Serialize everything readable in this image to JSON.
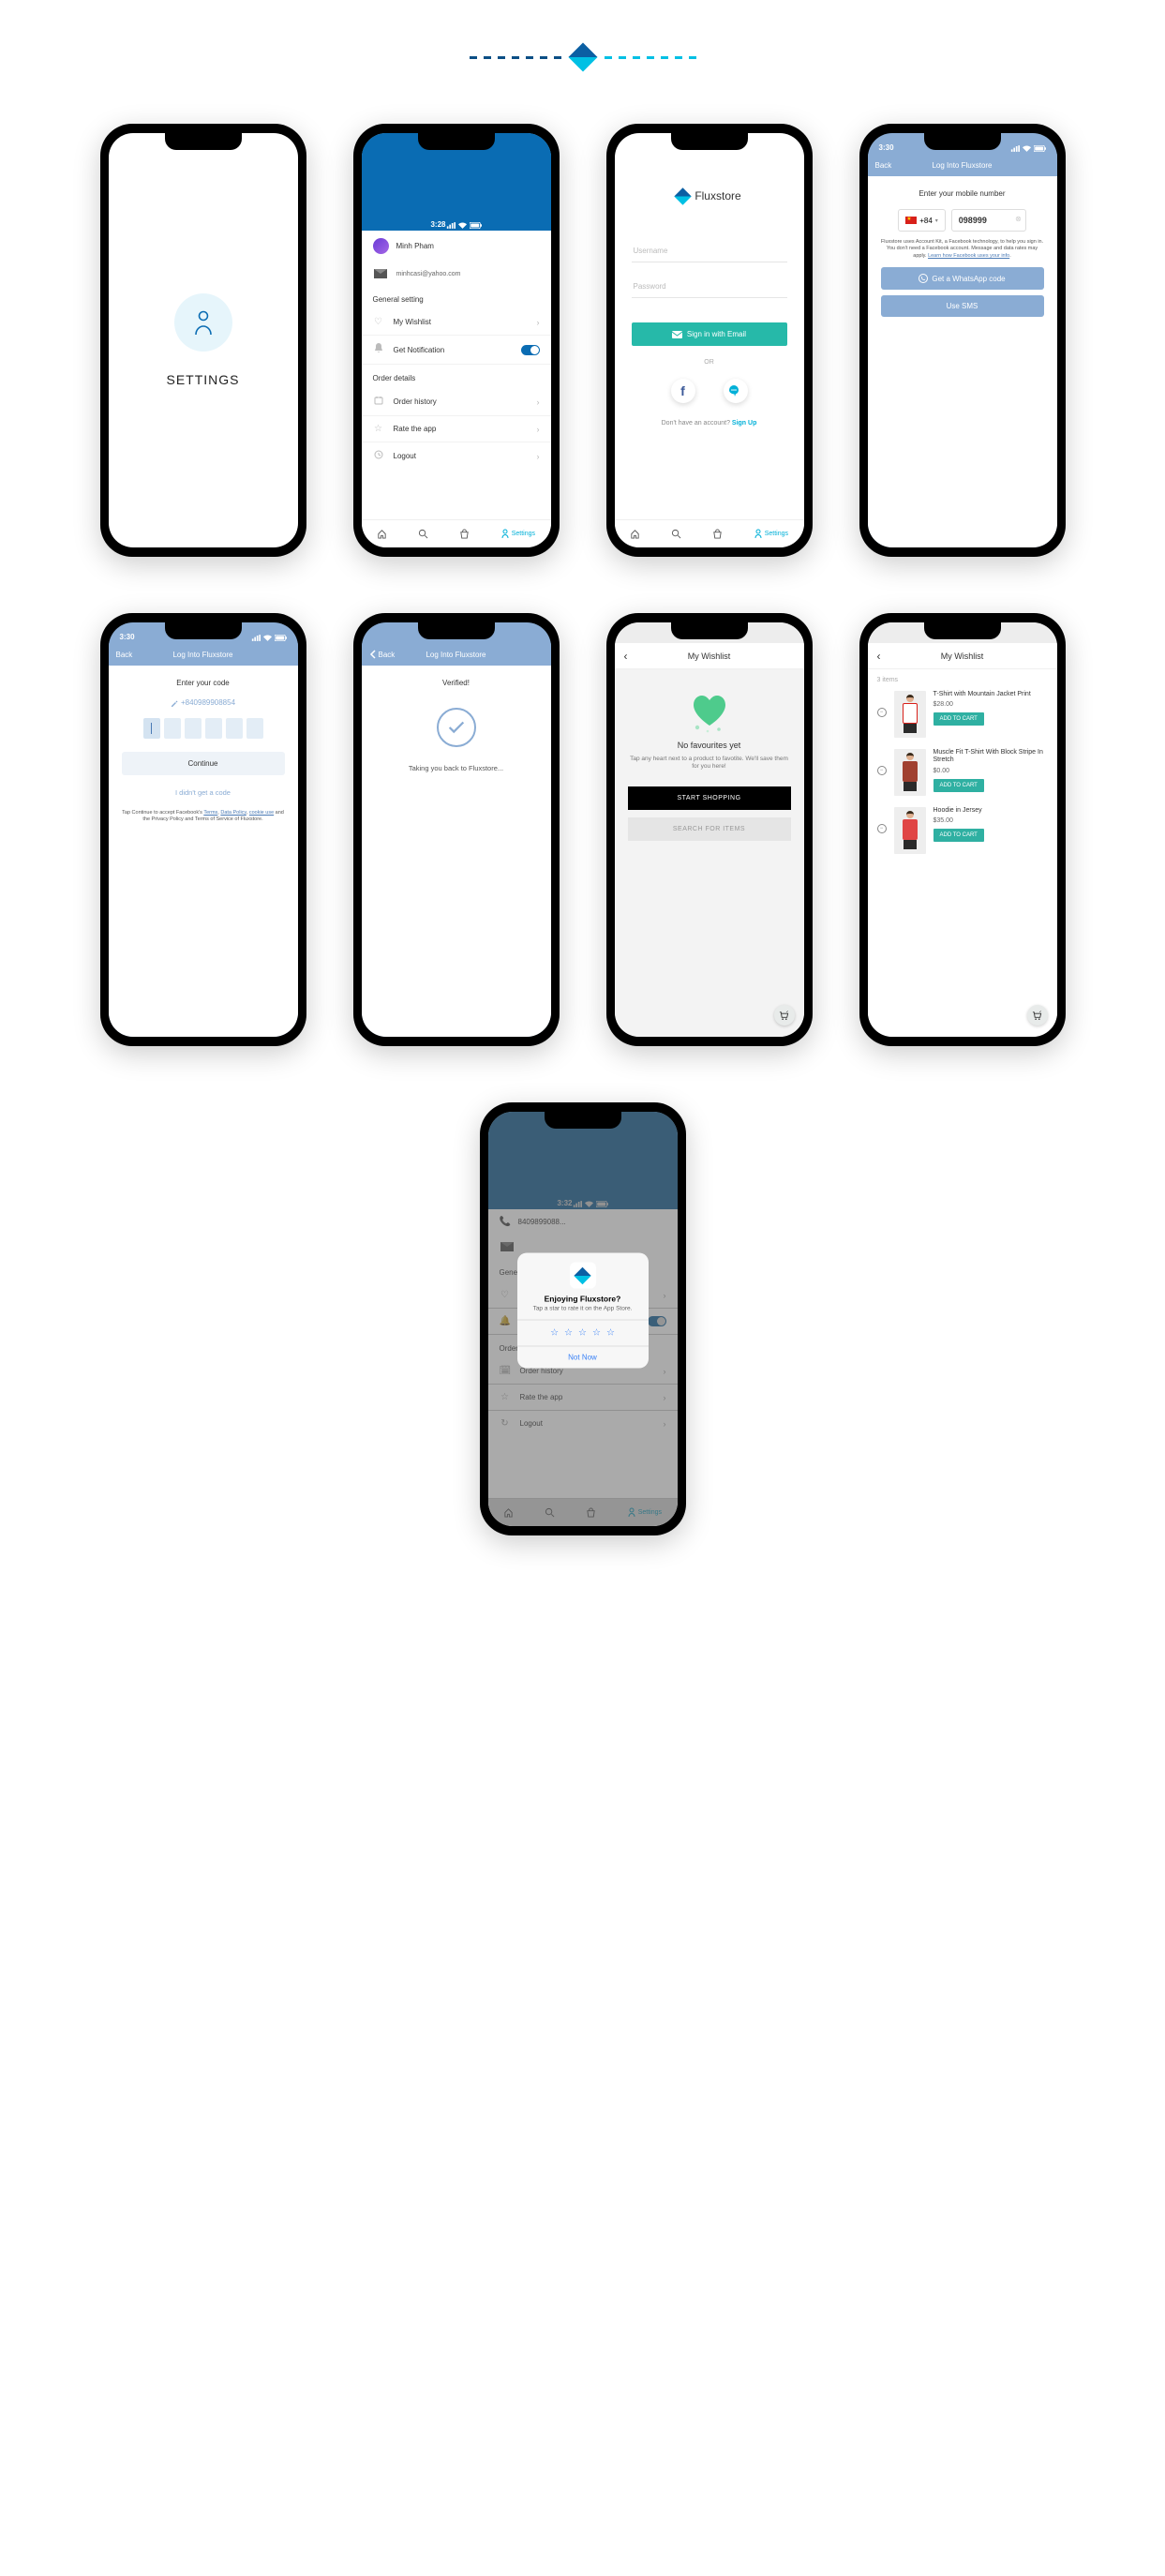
{
  "intro_title": "SETTINGS",
  "settings": {
    "time": "3:28",
    "title": "Settings",
    "user_name": "Minh Pham",
    "user_email": "minhcasi@yahoo.com",
    "general_h": "General setting",
    "wishlist": "My Wishlist",
    "notif": "Get Notification",
    "order_h": "Order details",
    "history": "Order history",
    "rate": "Rate the app",
    "logout": "Logout",
    "tab_settings": "Settings"
  },
  "login": {
    "brand": "Fluxstore",
    "user_ph": "Username",
    "pass_ph": "Password",
    "signin": "Sign in with Email",
    "or": "OR",
    "noacct": "Don't have an account? ",
    "signup": "Sign Up",
    "tab_settings": "Settings"
  },
  "ak_phone": {
    "time": "3:30",
    "back": "Back",
    "title": "Log Into Fluxstore",
    "prompt": "Enter your mobile number",
    "cc": "+84",
    "number": "098999",
    "fine": "Fluxstore uses Account Kit, a Facebook technology, to help you sign in. You don't need a Facebook account. Message and data rates may apply. ",
    "learn": "Learn how Facebook uses your info",
    "btn1": "Get a WhatsApp code",
    "btn2": "Use SMS"
  },
  "ak_code": {
    "time": "3:30",
    "back": "Back",
    "title": "Log Into Fluxstore",
    "prompt": "Enter your code",
    "phone": "+840989908854",
    "continue": "Continue",
    "nocode": "I didn't get a code",
    "fine": "Tap Continue to accept Facebook's ",
    "terms": "Terms",
    "comma": ", ",
    "dp": "Data Policy",
    "cu": "cookie use",
    "and": " and the Privacy Policy and Terms of Service of Fluxstore."
  },
  "ak_ok": {
    "back": "Back",
    "title": "Log Into Fluxstore",
    "verified": "Verified!",
    "msg": "Taking you back to Fluxstore..."
  },
  "wish_empty": {
    "title": "My Wishlist",
    "h": "No favourites yet",
    "p": "Tap any heart next to a product to favotite. We'll save them for you here!",
    "start": "START SHOPPING",
    "search": "SEARCH FOR ITEMS"
  },
  "wish_list": {
    "title": "My Wishlist",
    "count": "3 items",
    "atc": "ADD TO CART",
    "items": [
      {
        "name": "T-Shirt with Mountain Jacket Print",
        "price": "$28.00",
        "shirt": "#fff",
        "accent": "#d8201a"
      },
      {
        "name": "Muscle Fit T-Shirt With Block Stripe In Stretch",
        "price": "$0.00",
        "shirt": "#a04030",
        "accent": "#a04030"
      },
      {
        "name": "Hoodie in Jersey",
        "price": "$35.00",
        "shirt": "#e04545",
        "accent": "#e04545"
      }
    ]
  },
  "rating": {
    "time": "3:32",
    "title": "Settings",
    "phone_row": "8409899088...",
    "general_h": "Gener",
    "history": "Order history",
    "rate": "Rate the app",
    "logout": "Logout",
    "order_h": "Order details",
    "tab_settings": "Settings",
    "m_title": "Enjoying Fluxstore?",
    "m_sub": "Tap a star to rate it on the App Store.",
    "notnow": "Not Now"
  }
}
